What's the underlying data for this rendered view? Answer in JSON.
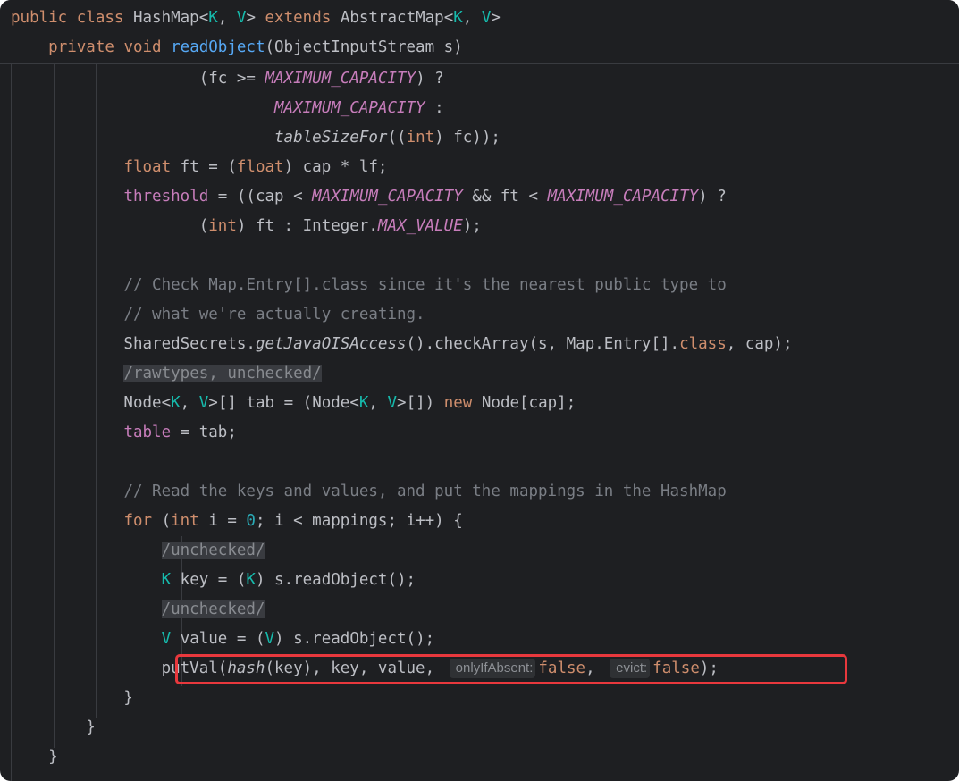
{
  "editor": {
    "sticky_lines": [
      {
        "segments": [
          {
            "text": "public class ",
            "style": "kw"
          },
          {
            "text": "HashMap<"
          },
          {
            "text": "K",
            "style": "tp"
          },
          {
            "text": ", "
          },
          {
            "text": "V",
            "style": "tp"
          },
          {
            "text": "> "
          },
          {
            "text": "extends",
            "style": "kw"
          },
          {
            "text": " AbstractMap<"
          },
          {
            "text": "K",
            "style": "tp"
          },
          {
            "text": ", "
          },
          {
            "text": "V",
            "style": "tp"
          },
          {
            "text": ">"
          }
        ]
      },
      {
        "segments": [
          {
            "text": "    "
          },
          {
            "text": "private void ",
            "style": "kw"
          },
          {
            "text": "readObject",
            "style": "fn"
          },
          {
            "text": "(ObjectInputStream s)"
          }
        ]
      }
    ],
    "lines": [
      {
        "segments": [
          {
            "text": "                    (fc >= "
          },
          {
            "text": "MAXIMUM_CAPACITY",
            "style": "cst"
          },
          {
            "text": ") ?"
          }
        ]
      },
      {
        "segments": [
          {
            "text": "                            "
          },
          {
            "text": "MAXIMUM_CAPACITY",
            "style": "cst"
          },
          {
            "text": " :"
          }
        ]
      },
      {
        "segments": [
          {
            "text": "                            "
          },
          {
            "text": "tableSizeFor",
            "style": "st"
          },
          {
            "text": "(("
          },
          {
            "text": "int",
            "style": "kw"
          },
          {
            "text": ") fc));"
          }
        ]
      },
      {
        "segments": [
          {
            "text": "            "
          },
          {
            "text": "float",
            "style": "kw"
          },
          {
            "text": " ft = ("
          },
          {
            "text": "float",
            "style": "kw"
          },
          {
            "text": ") cap * lf;"
          }
        ]
      },
      {
        "segments": [
          {
            "text": "            "
          },
          {
            "text": "threshold",
            "style": "fld"
          },
          {
            "text": " = ((cap < "
          },
          {
            "text": "MAXIMUM_CAPACITY",
            "style": "cst"
          },
          {
            "text": " && ft < "
          },
          {
            "text": "MAXIMUM_CAPACITY",
            "style": "cst"
          },
          {
            "text": ") ?"
          }
        ]
      },
      {
        "segments": [
          {
            "text": "                    ("
          },
          {
            "text": "int",
            "style": "kw"
          },
          {
            "text": ") ft : Integer."
          },
          {
            "text": "MAX_VALUE",
            "style": "cst"
          },
          {
            "text": ");"
          }
        ]
      },
      {
        "segments": []
      },
      {
        "segments": [
          {
            "text": "            "
          },
          {
            "text": "// Check Map.Entry[].class since it's the nearest public type to",
            "style": "cmt"
          }
        ]
      },
      {
        "segments": [
          {
            "text": "            "
          },
          {
            "text": "// what we're actually creating.",
            "style": "cmt"
          }
        ]
      },
      {
        "segments": [
          {
            "text": "            SharedSecrets."
          },
          {
            "text": "getJavaOISAccess",
            "style": "st"
          },
          {
            "text": "().checkArray(s, Map.Entry[]."
          },
          {
            "text": "class",
            "style": "kw"
          },
          {
            "text": ", cap);"
          }
        ]
      },
      {
        "segments": [
          {
            "text": "            "
          },
          {
            "text": "/rawtypes, unchecked/",
            "style": "sup"
          }
        ]
      },
      {
        "segments": [
          {
            "text": "            Node<"
          },
          {
            "text": "K",
            "style": "tp"
          },
          {
            "text": ", "
          },
          {
            "text": "V",
            "style": "tp"
          },
          {
            "text": ">[] tab = (Node<"
          },
          {
            "text": "K",
            "style": "tp"
          },
          {
            "text": ", "
          },
          {
            "text": "V",
            "style": "tp"
          },
          {
            "text": ">[]) "
          },
          {
            "text": "new",
            "style": "kw"
          },
          {
            "text": " Node[cap];"
          }
        ]
      },
      {
        "segments": [
          {
            "text": "            "
          },
          {
            "text": "table",
            "style": "fld"
          },
          {
            "text": " = tab;"
          }
        ]
      },
      {
        "segments": []
      },
      {
        "segments": [
          {
            "text": "            "
          },
          {
            "text": "// Read the keys and values, and put the mappings in the HashMap",
            "style": "cmt"
          }
        ]
      },
      {
        "segments": [
          {
            "text": "            "
          },
          {
            "text": "for",
            "style": "kw"
          },
          {
            "text": " ("
          },
          {
            "text": "int",
            "style": "kw"
          },
          {
            "text": " i = "
          },
          {
            "text": "0",
            "style": "num"
          },
          {
            "text": "; i < mappings; i++) {"
          }
        ]
      },
      {
        "segments": [
          {
            "text": "                "
          },
          {
            "text": "/unchecked/",
            "style": "sup"
          }
        ]
      },
      {
        "segments": [
          {
            "text": "                "
          },
          {
            "text": "K",
            "style": "tp"
          },
          {
            "text": " key = ("
          },
          {
            "text": "K",
            "style": "tp"
          },
          {
            "text": ") s.readObject();"
          }
        ]
      },
      {
        "segments": [
          {
            "text": "                "
          },
          {
            "text": "/unchecked/",
            "style": "sup"
          }
        ]
      },
      {
        "segments": [
          {
            "text": "                "
          },
          {
            "text": "V",
            "style": "tp"
          },
          {
            "text": " value = ("
          },
          {
            "text": "V",
            "style": "tp"
          },
          {
            "text": ") s.readObject();"
          }
        ]
      },
      {
        "segments": [
          {
            "text": "                putVal("
          },
          {
            "text": "hash",
            "style": "st"
          },
          {
            "text": "(key), key, value, "
          },
          {
            "text": "onlyIfAbsent:",
            "style": "hint"
          },
          {
            "text": "false",
            "style": "kw"
          },
          {
            "text": ", "
          },
          {
            "text": "evict:",
            "style": "hint"
          },
          {
            "text": "false",
            "style": "kw"
          },
          {
            "text": ");"
          }
        ]
      },
      {
        "segments": [
          {
            "text": "            }"
          }
        ]
      },
      {
        "segments": [
          {
            "text": "        }"
          }
        ]
      },
      {
        "segments": [
          {
            "text": "    }"
          }
        ]
      }
    ]
  },
  "colors": {
    "background": "#1e1f22",
    "keyword": "#cf8e6d",
    "type_param": "#16baac",
    "constant": "#c77dbb",
    "method_decl": "#56a8f5",
    "comment": "#7a7e85",
    "highlight_border": "#e8383d"
  }
}
